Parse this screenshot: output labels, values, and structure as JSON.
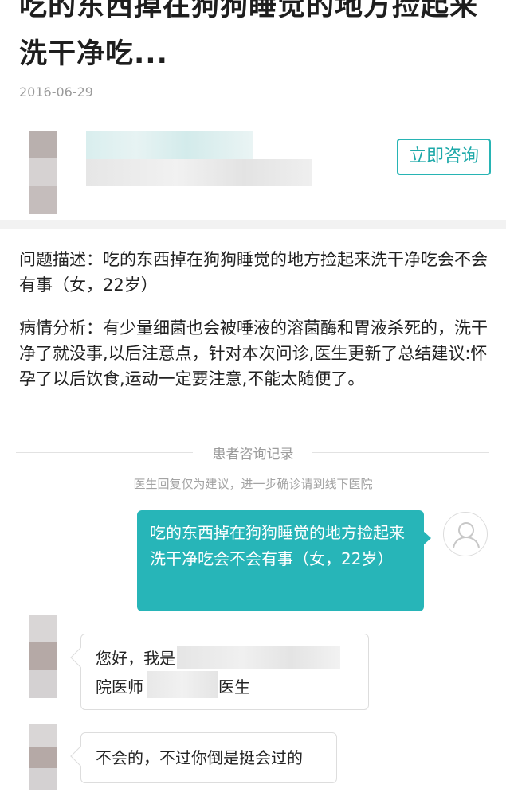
{
  "article": {
    "title": "吃的东西掉在狗狗睡觉的地方捡起来洗干净吃...",
    "date": "2016-06-29"
  },
  "doctor_card": {
    "consult_button": "立即咨询"
  },
  "question": {
    "description": "问题描述：吃的东西掉在狗狗睡觉的地方捡起来洗干净吃会不会有事（女，22岁）",
    "analysis": "病情分析：有少量细菌也会被唾液的溶菌酶和胃液杀死的，洗干净了就没事,以后注意点，针对本次问诊,医生更新了总结建议:怀孕了以后饮食,运动一定要注意,不能太随便了。"
  },
  "records": {
    "header": "患者咨询记录",
    "notice": "医生回复仅为建议，进一步确诊请到线下医院"
  },
  "chat": {
    "user_message": "吃的东西掉在狗狗睡觉的地方捡起来洗干净吃会不会有事（女，22岁）",
    "doctor_greeting_part1": "您好，我是",
    "doctor_greeting_part2": "院医师",
    "doctor_greeting_part3": "医生",
    "doctor_reply": "不会的，不过你倒是挺会过的"
  },
  "colors": {
    "accent": "#27b5b8",
    "divider": "#f2f2f2"
  },
  "icons": {
    "user_avatar": "person-outline-icon"
  }
}
